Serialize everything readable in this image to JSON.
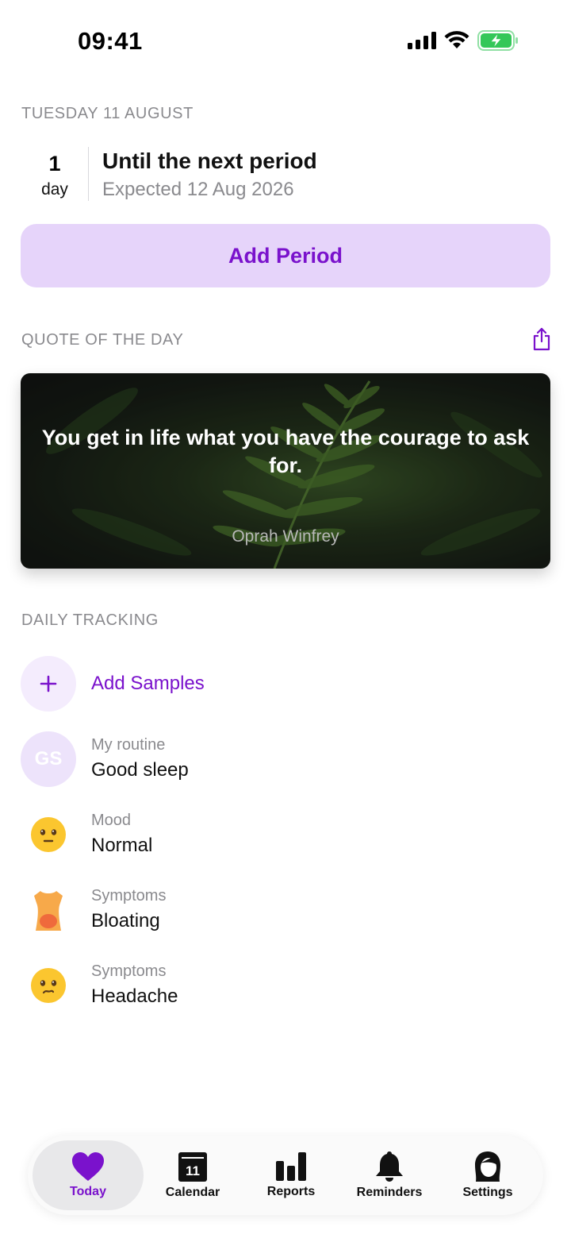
{
  "status_bar": {
    "time": "09:41"
  },
  "date_header": "TUESDAY 11 AUGUST",
  "countdown": {
    "number": "1",
    "unit": "day",
    "title": "Until the next period",
    "subtitle": "Expected 12 Aug 2026"
  },
  "add_period_label": "Add Period",
  "quote_section": {
    "label": "QUOTE OF THE DAY",
    "text": "You get in life what you have the courage to ask for.",
    "author": "Oprah Winfrey"
  },
  "tracking": {
    "label": "DAILY TRACKING",
    "add_samples_label": "Add Samples",
    "items": [
      {
        "category": "My routine",
        "value": "Good sleep",
        "icon": "initials-icon",
        "initials": "GS"
      },
      {
        "category": "Mood",
        "value": "Normal",
        "icon": "neutral-face-icon"
      },
      {
        "category": "Symptoms",
        "value": "Bloating",
        "icon": "torso-icon"
      },
      {
        "category": "Symptoms",
        "value": "Headache",
        "icon": "confused-face-icon"
      }
    ]
  },
  "tab_bar": {
    "tabs": [
      {
        "label": "Today",
        "icon": "heart-icon",
        "active": true
      },
      {
        "label": "Calendar",
        "icon": "calendar-icon",
        "badge": "11"
      },
      {
        "label": "Reports",
        "icon": "bar-chart-icon"
      },
      {
        "label": "Reminders",
        "icon": "bell-icon"
      },
      {
        "label": "Settings",
        "icon": "person-icon"
      }
    ]
  },
  "colors": {
    "accent": "#7a12cc",
    "accent_light": "#e6d4fa",
    "secondary_text": "#8a8a8e",
    "battery_green": "#34c759"
  }
}
